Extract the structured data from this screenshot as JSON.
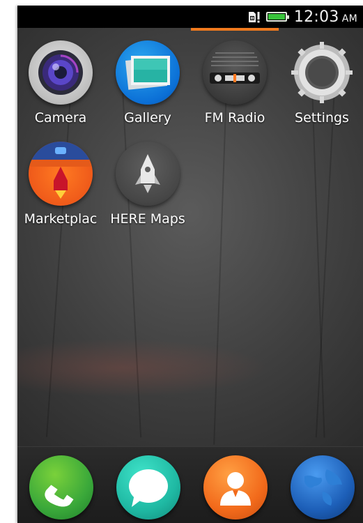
{
  "status_bar": {
    "time": "12:03",
    "ampm": "AM",
    "icons": [
      "sim-warning-icon",
      "battery-icon"
    ],
    "battery_color": "#39c43b"
  },
  "page_indicator_color": "#f07a1e",
  "home_apps": [
    {
      "label": "Camera",
      "icon": "camera-icon"
    },
    {
      "label": "Gallery",
      "icon": "gallery-icon"
    },
    {
      "label": "FM Radio",
      "icon": "fm-radio-icon"
    },
    {
      "label": "Settings",
      "icon": "settings-gear-icon"
    },
    {
      "label": "Marketplac",
      "icon": "marketplace-icon"
    },
    {
      "label": "HERE Maps",
      "icon": "here-maps-icon"
    }
  ],
  "dock_apps": [
    {
      "icon": "phone-icon"
    },
    {
      "icon": "messages-icon"
    },
    {
      "icon": "contacts-icon"
    },
    {
      "icon": "browser-globe-icon"
    }
  ]
}
